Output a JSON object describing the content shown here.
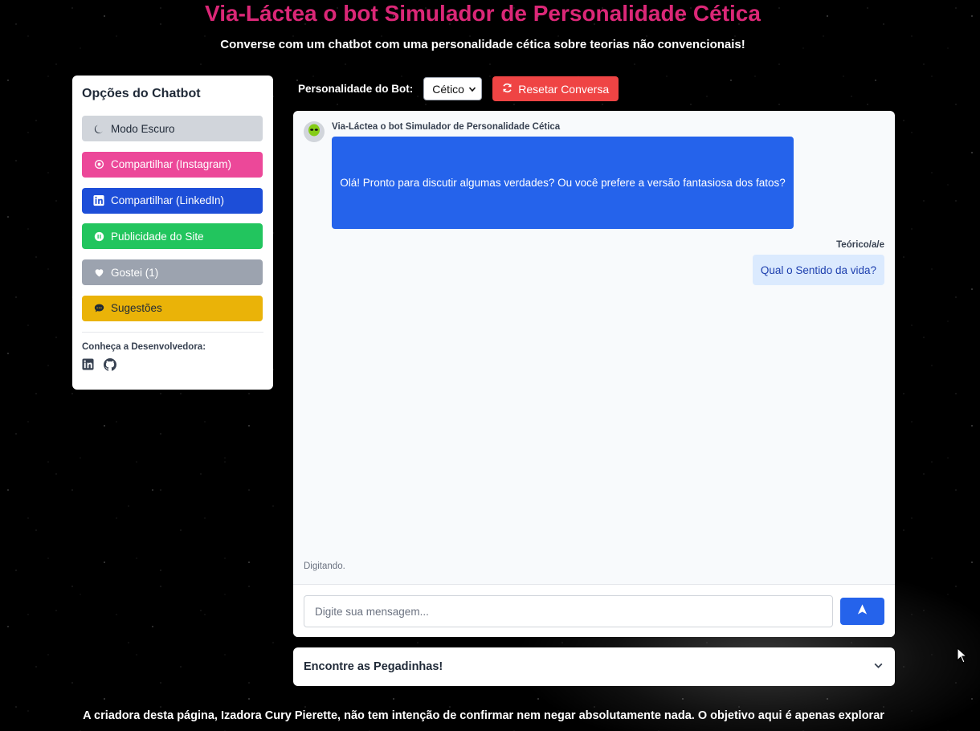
{
  "header": {
    "title": "Via-Láctea o bot Simulador de Personalidade Cética",
    "subtitle": "Converse com um chatbot com uma personalidade cética sobre teorias não convencionais!"
  },
  "sidebar": {
    "title": "Opções do Chatbot",
    "buttons": [
      {
        "label": "Modo Escuro",
        "icon": "moon-icon"
      },
      {
        "label": "Compartilhar (Instagram)",
        "icon": "instagram-icon"
      },
      {
        "label": "Compartilhar (LinkedIn)",
        "icon": "linkedin-icon"
      },
      {
        "label": "Publicidade do Site",
        "icon": "ad-icon"
      },
      {
        "label": "Gostei (1)",
        "icon": "heart-icon"
      },
      {
        "label": "Sugestões",
        "icon": "comment-icon"
      }
    ],
    "dev_label": "Conheça a Desenvolvedora:",
    "dev_icons": [
      "linkedin-icon",
      "github-icon"
    ]
  },
  "controls": {
    "personality_label": "Personalidade do Bot:",
    "personality_selected": "Cético",
    "reset_label": "Resetar Conversa"
  },
  "chat": {
    "bot_name": "Via-Láctea o bot Simulador de Personalidade Cética",
    "bot_message": "Olá! Pronto para discutir algumas verdades? Ou você prefere a versão fantasiosa dos fatos?",
    "user_name": "Teórico/a/e",
    "user_message": "Qual o Sentido da vida?",
    "typing": "Digitando.",
    "input_placeholder": "Digite sua mensagem..."
  },
  "accordion": {
    "title": "Encontre as Pegadinhas!"
  },
  "footer": {
    "text": "A criadora desta página, Izadora Cury Pierette, não tem intenção de confirmar nem negar absolutamente nada. O objetivo aqui é apenas explorar"
  },
  "colors": {
    "title": "#db2777",
    "bot_bubble": "#2563eb",
    "user_bubble": "#dbeafe",
    "reset": "#ef4444",
    "instagram": "#ec4899",
    "linkedin": "#1d4ed8",
    "ad": "#22c55e",
    "like": "#9ca3af",
    "suggestions": "#eab308",
    "dark_mode": "#d1d5db"
  }
}
